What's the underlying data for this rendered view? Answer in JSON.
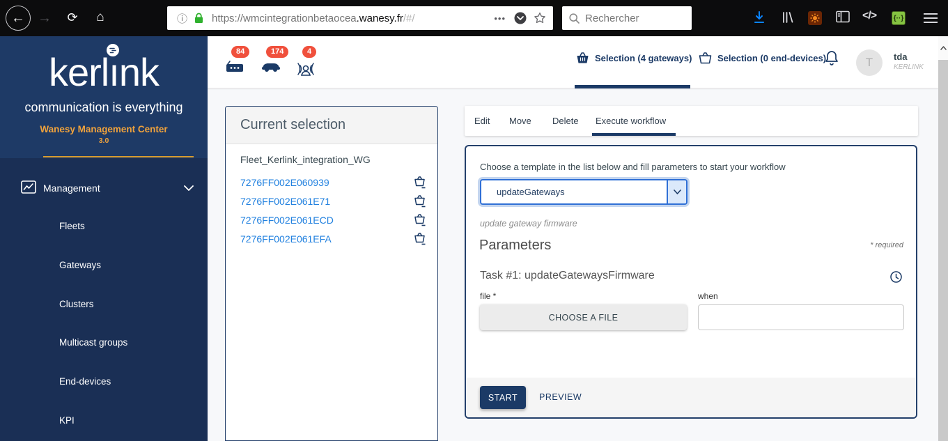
{
  "colors": {
    "navy": "#1b3a66",
    "sidebar_top": "#1e3a66",
    "sidebar_bottom": "#1a2f55",
    "badge_red": "#f0503c",
    "link_blue": "#2080df",
    "gold": "#e8a33d",
    "firefox_accent_blue": "#0a84ff",
    "lock_green": "#2fb12e",
    "select_focus_blue": "#3070d6"
  },
  "browser": {
    "back_icon": "←",
    "forward_icon": "→",
    "reload_icon": "⟳",
    "home_icon": "⌂",
    "info_icon": "ⓘ",
    "url_host": "https://wmcintegrationbetaocea",
    "url_domain": ".wanesy.fr",
    "url_path": "/#/",
    "page_actions_icon": "•••",
    "search_placeholder": "Rechercher",
    "code_icon": "</>",
    "green_ext_icon": "{··}"
  },
  "sidebar": {
    "logo_prefix": "kerl",
    "logo_i": "ı",
    "logo_suffix": "nk",
    "tagline": "communication is everything",
    "product": "Wanesy Management Center",
    "version": "3.0",
    "management": "Management",
    "items": [
      {
        "label": "Fleets"
      },
      {
        "label": "Gateways"
      },
      {
        "label": "Clusters"
      },
      {
        "label": "Multicast groups"
      },
      {
        "label": "End-devices"
      },
      {
        "label": "KPI"
      }
    ]
  },
  "header": {
    "badges": [
      {
        "icon": "gateway-router-icon",
        "count": "84"
      },
      {
        "icon": "vehicle-icon",
        "count": "174"
      },
      {
        "icon": "broadcast-user-icon",
        "count": "4"
      }
    ],
    "selection_gateways": "Selection (4 gateways)",
    "selection_end_devices": "Selection (0 end-devices)",
    "user_initial": "T",
    "user_name": "tda",
    "user_org": "KERLINK"
  },
  "selection_panel": {
    "title": "Current selection",
    "fleet_name": "Fleet_Kerlink_integration_WG",
    "gateways": [
      "7276FF002E060939",
      "7276FF002E061E71",
      "7276FF002E061ECD",
      "7276FF002E061EFA"
    ]
  },
  "tabs": {
    "items": [
      {
        "label": "Edit"
      },
      {
        "label": "Move"
      },
      {
        "label": "Delete"
      },
      {
        "label": "Execute workflow"
      }
    ],
    "active": "Execute workflow"
  },
  "workflow": {
    "instructions": "Choose a template in the list below and fill parameters to start your workflow",
    "template_selected": "updateGateways",
    "template_description": "update gateway firmware",
    "parameters_title": "Parameters",
    "required_note": "* required",
    "task_title": "Task #1: updateGatewaysFirmware",
    "file_label": "file *",
    "when_label": "when",
    "when_value": "",
    "choose_file_button": "CHOOSE A FILE",
    "start_button": "START",
    "preview_button": "PREVIEW"
  }
}
